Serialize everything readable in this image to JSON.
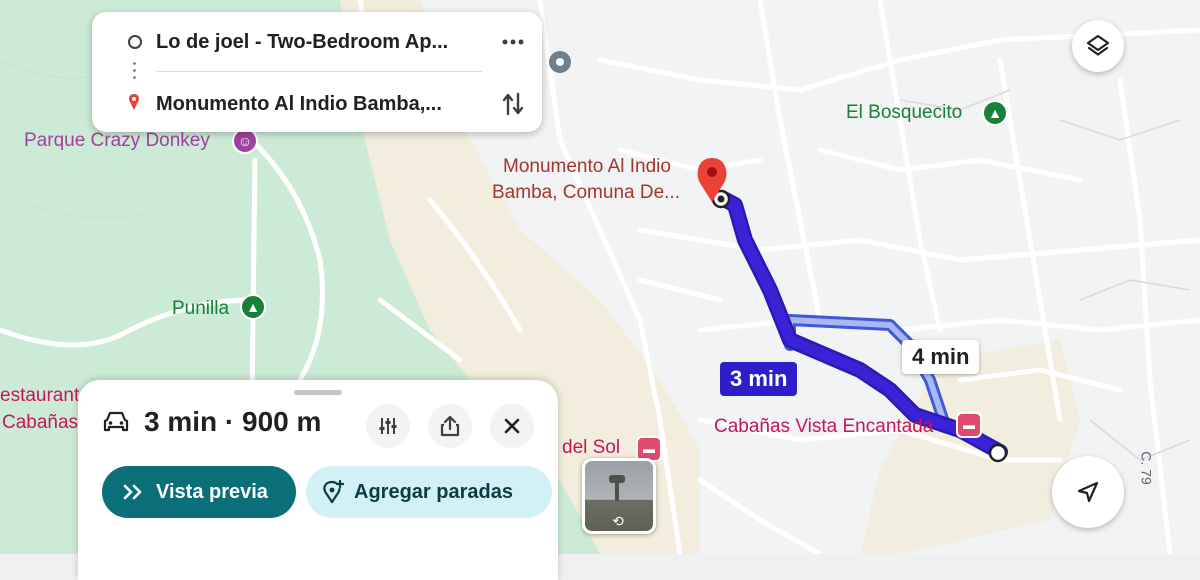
{
  "route": {
    "origin": "Lo de joel - Two-Bedroom Ap...",
    "destination": "Monumento Al Indio Bamba,..."
  },
  "map_labels": {
    "crazy_donkey": "Parque Crazy Donkey",
    "bosquecito": "El Bosquecito",
    "punilla": "Punilla",
    "monument_line1": "Monumento Al Indio",
    "monument_line2": "Bamba, Comuna De...",
    "restaurant": "estaurant",
    "cabanas_left": "Cabañas",
    "del_sol": "del Sol",
    "vista_encantada": "Cabañas Vista Encantada",
    "street": "C. 79"
  },
  "route_bubbles": {
    "primary": "3 min",
    "alternative": "4 min"
  },
  "sheet": {
    "summary": "3 min · 900 m",
    "preview_label": "Vista previa",
    "add_stops_label": "Agregar paradas"
  },
  "colors": {
    "route_primary": "#3b22d6",
    "route_alt": "#5b6fe0",
    "accent_teal": "#0b6f7a",
    "pin_red": "#ea4335"
  },
  "icons": [
    "car-icon",
    "filter-icon",
    "share-icon",
    "close-icon",
    "more-icon",
    "swap-icon",
    "layers-icon",
    "navigation-arrow-icon",
    "add-stop-icon",
    "chevron-double-icon"
  ]
}
